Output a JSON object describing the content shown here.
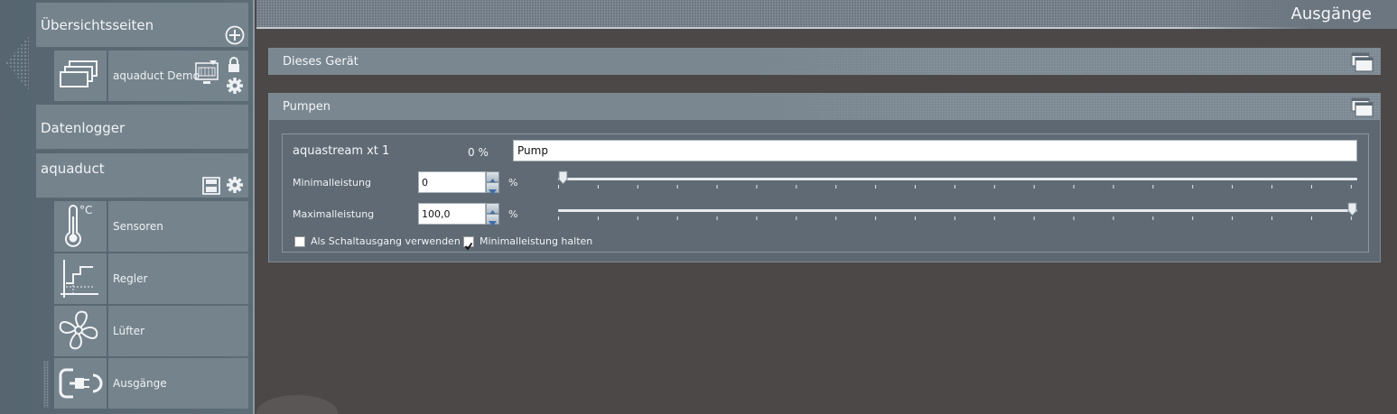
{
  "sidebar": {
    "overview": {
      "title": "Übersichtsseiten"
    },
    "overview_items": [
      {
        "label": "aquaduct Demo"
      }
    ],
    "datalogger": {
      "title": "Datenlogger"
    },
    "device": {
      "title": "aquaduct"
    },
    "device_items": [
      {
        "label": "Sensoren",
        "icon": "thermometer-icon",
        "unit_text": "°C"
      },
      {
        "label": "Regler",
        "icon": "controller-icon"
      },
      {
        "label": "Lüfter",
        "icon": "fan-icon"
      },
      {
        "label": "Ausgänge",
        "icon": "plug-icon"
      }
    ]
  },
  "header": {
    "title": "Ausgänge"
  },
  "sections": [
    {
      "title": "Dieses Gerät"
    },
    {
      "title": "Pumpen"
    }
  ],
  "pump": {
    "name": "aquastream xt 1",
    "percent_text": "0 %",
    "name_value": "Pump",
    "min_label": "Minimalleistung",
    "min_value": "0",
    "min_unit": "%",
    "max_label": "Maximalleistung",
    "max_value": "100,0",
    "max_unit": "%",
    "slider_min_fraction": 0.0,
    "slider_max_fraction": 1.0,
    "switch_output_label": "Als Schaltausgang verwenden",
    "switch_output_checked": false,
    "hold_min_label": "Minimalleistung halten",
    "hold_min_checked": true
  },
  "colors": {
    "sidebar_bg": "#5c6c77",
    "tile_bg": "#75838d",
    "main_bg": "#4c4848",
    "section_bg": "#5d6872"
  }
}
